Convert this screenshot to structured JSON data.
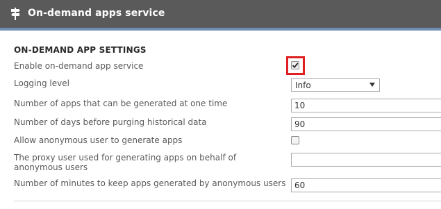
{
  "header": {
    "title": "On-demand apps service",
    "icon": "signpost-icon"
  },
  "section": {
    "title": "ON-DEMAND APP SETTINGS"
  },
  "settings": {
    "enable": {
      "label": "Enable on-demand app service",
      "checked": true
    },
    "logging": {
      "label": "Logging level",
      "value": "Info"
    },
    "apps_count": {
      "label": "Number of apps that can be generated at one time",
      "value": "10"
    },
    "purge_days": {
      "label": "Number of days before purging historical data",
      "value": "90"
    },
    "anonymous": {
      "label": "Allow anonymous user to generate apps",
      "checked": false
    },
    "proxy_user": {
      "label": "The proxy user used for generating apps on behalf of anonymous users",
      "value": ""
    },
    "keep_minutes": {
      "label": "Number of minutes to keep apps generated by anonymous users",
      "value": "60"
    }
  },
  "colors": {
    "header_bg": "#5a5a5a",
    "header_accent": "#6e8fb3",
    "highlight": "#e02020"
  }
}
